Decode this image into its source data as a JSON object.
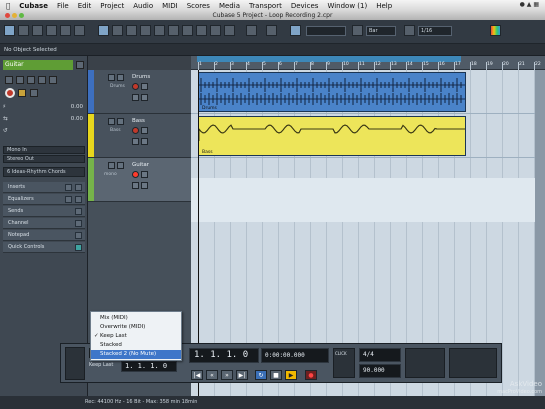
{
  "menubar": {
    "app_name": "Cubase",
    "items": [
      "File",
      "Edit",
      "Project",
      "Audio",
      "MIDI",
      "Scores",
      "Media",
      "Transport",
      "Devices",
      "Window (1)",
      "Help"
    ]
  },
  "window": {
    "title": "Cubase 5 Project - Loop Recording 2.cpr"
  },
  "toolbar": {
    "quantize": "Bar",
    "grid_value": "1/16"
  },
  "infobar": {
    "text": "No Object Selected"
  },
  "inspector": {
    "track_name": "Guitar",
    "volume_value": "0.00",
    "pan_value": "0.00",
    "routing_in": "Mono In",
    "routing_out": "Stereo Out",
    "preset": "6 Ideas-Rhythm Chords",
    "sections": [
      "Inserts",
      "Equalizers",
      "Sends",
      "Channel",
      "Notepad",
      "Quick Controls"
    ]
  },
  "tracks": [
    {
      "name": "Drums",
      "sub": "Drums",
      "color": "#3d6fbf"
    },
    {
      "name": "Bass",
      "sub": "Bass",
      "color": "#e8d71d"
    },
    {
      "name": "Guitar",
      "sub": "mono",
      "color": "#76b34a"
    }
  ],
  "parts": [
    {
      "name": "Drums",
      "color": "#4a83c9"
    },
    {
      "name": "Bass",
      "color": "#ede55a"
    }
  ],
  "ruler": {
    "marks": [
      "1",
      "2",
      "3",
      "4",
      "5",
      "6",
      "7",
      "8",
      "9",
      "10",
      "11",
      "12",
      "13",
      "14",
      "15",
      "16",
      "17",
      "18",
      "19",
      "20",
      "21",
      "22"
    ]
  },
  "transport": {
    "position_main": "1. 1. 1. 0",
    "position_secondary": "0:00:00.000",
    "left_locator": "1. 1. 1. 0",
    "tempo": "90.000",
    "signature": "4/4",
    "mode_label": "Keep Last",
    "click_label": "CLICK"
  },
  "record_mode_menu": {
    "items": [
      {
        "label": "Mix (MIDI)",
        "checked": false,
        "highlighted": false
      },
      {
        "label": "Overwrite (MIDI)",
        "checked": false,
        "highlighted": false
      },
      {
        "label": "Keep Last",
        "checked": true,
        "highlighted": false
      },
      {
        "label": "Stacked",
        "checked": false,
        "highlighted": false
      },
      {
        "label": "Stacked 2 (No Mute)",
        "checked": false,
        "highlighted": true
      }
    ]
  },
  "statusbar": {
    "text": "Rec: 44100 Hz - 16 Bit - Max: 358 min 18min"
  },
  "watermark": {
    "line1": "AskVideo",
    "line2": "macProVideo.com"
  }
}
